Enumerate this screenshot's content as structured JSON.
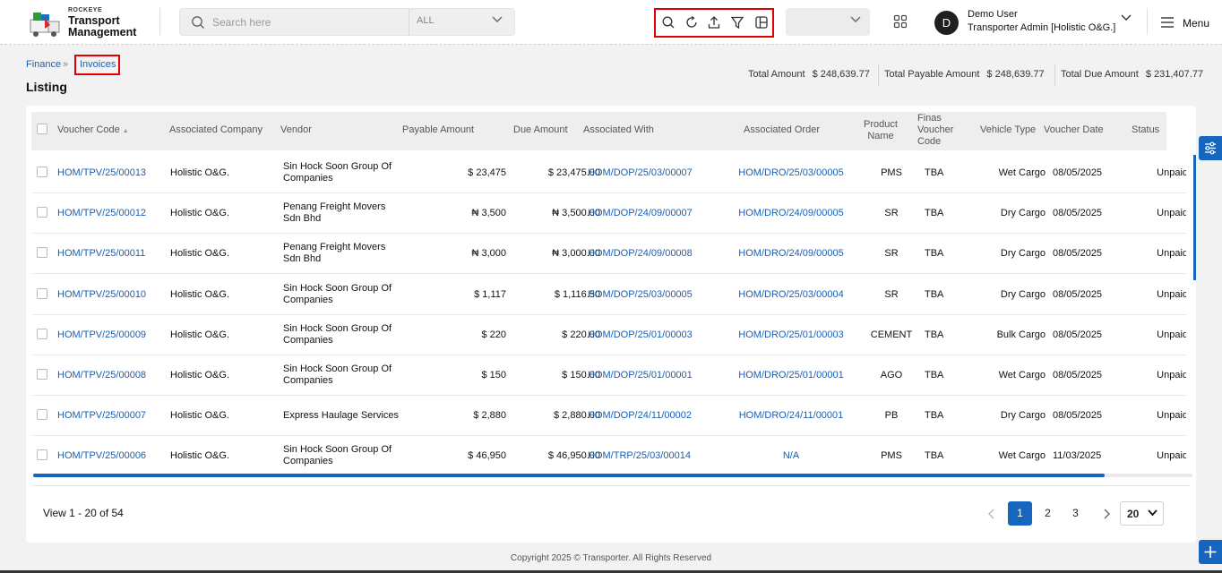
{
  "brand": {
    "small": "ROCKEYE",
    "title_line1": "Transport",
    "title_line2": "Management"
  },
  "search": {
    "placeholder": "Search here",
    "category": "ALL"
  },
  "toolbar": {
    "icons": [
      "search-icon",
      "refresh-icon",
      "upload-icon",
      "filter-icon",
      "columns-icon"
    ]
  },
  "user": {
    "initial": "D",
    "name": "Demo User",
    "role": "Transporter Admin [Holistic O&G.]"
  },
  "menu": {
    "label": "Menu"
  },
  "breadcrumb": {
    "parent": "Finance",
    "sep": "»",
    "current": "Invoices"
  },
  "page": {
    "title": "Listing"
  },
  "totals": {
    "total_amount_label": "Total Amount",
    "total_amount": "$ 248,639.77",
    "total_payable_label": "Total Payable Amount",
    "total_payable": "$ 248,639.77",
    "total_due_label": "Total Due Amount",
    "total_due": "$ 231,407.77"
  },
  "table": {
    "headers": {
      "voucher_code": "Voucher Code",
      "sort_icon": "▲",
      "associated_company": "Associated Company",
      "vendor": "Vendor",
      "payable_amount": "Payable Amount",
      "due_amount": "Due Amount",
      "associated_with": "Associated With",
      "associated_order": "Associated Order",
      "product_name_1": "Product",
      "product_name_2": "Name",
      "finas_1": "Finas",
      "finas_2": "Voucher",
      "finas_3": "Code",
      "vehicle_type": "Vehicle Type",
      "voucher_date": "Voucher Date",
      "status": "Status"
    },
    "rows": [
      {
        "code": "HOM/TPV/25/00013",
        "company": "Holistic O&G.",
        "vendor1": "Sin Hock Soon Group Of",
        "vendor2": "Companies",
        "payable": "$ 23,475",
        "due": "$ 23,475.00",
        "with": "HOM/DOP/25/03/00007",
        "order": "HOM/DRO/25/03/00005",
        "product": "PMS",
        "finas": "TBA",
        "vehicle": "Wet Cargo",
        "date": "08/05/2025",
        "status": "Unpaid"
      },
      {
        "code": "HOM/TPV/25/00012",
        "company": "Holistic O&G.",
        "vendor1": "Penang Freight Movers",
        "vendor2": "Sdn Bhd",
        "payable": "₦ 3,500",
        "due": "₦ 3,500.00",
        "with": "HOM/DOP/24/09/00007",
        "order": "HOM/DRO/24/09/00005",
        "product": "SR",
        "finas": "TBA",
        "vehicle": "Dry Cargo",
        "date": "08/05/2025",
        "status": "Unpaid"
      },
      {
        "code": "HOM/TPV/25/00011",
        "company": "Holistic O&G.",
        "vendor1": "Penang Freight Movers",
        "vendor2": "Sdn Bhd",
        "payable": "₦ 3,000",
        "due": "₦ 3,000.00",
        "with": "HOM/DOP/24/09/00008",
        "order": "HOM/DRO/24/09/00005",
        "product": "SR",
        "finas": "TBA",
        "vehicle": "Dry Cargo",
        "date": "08/05/2025",
        "status": "Unpaid"
      },
      {
        "code": "HOM/TPV/25/00010",
        "company": "Holistic O&G.",
        "vendor1": "Sin Hock Soon Group Of",
        "vendor2": "Companies",
        "payable": "$ 1,117",
        "due": "$ 1,116.50",
        "with": "HOM/DOP/25/03/00005",
        "order": "HOM/DRO/25/03/00004",
        "product": "SR",
        "finas": "TBA",
        "vehicle": "Dry Cargo",
        "date": "08/05/2025",
        "status": "Unpaid"
      },
      {
        "code": "HOM/TPV/25/00009",
        "company": "Holistic O&G.",
        "vendor1": "Sin Hock Soon Group Of",
        "vendor2": "Companies",
        "payable": "$ 220",
        "due": "$ 220.00",
        "with": "HOM/DOP/25/01/00003",
        "order": "HOM/DRO/25/01/00003",
        "product": "CEMENT",
        "finas": "TBA",
        "vehicle": "Bulk Cargo",
        "date": "08/05/2025",
        "status": "Unpaid"
      },
      {
        "code": "HOM/TPV/25/00008",
        "company": "Holistic O&G.",
        "vendor1": "Sin Hock Soon Group Of",
        "vendor2": "Companies",
        "payable": "$ 150",
        "due": "$ 150.00",
        "with": "HOM/DOP/25/01/00001",
        "order": "HOM/DRO/25/01/00001",
        "product": "AGO",
        "finas": "TBA",
        "vehicle": "Wet Cargo",
        "date": "08/05/2025",
        "status": "Unpaid"
      },
      {
        "code": "HOM/TPV/25/00007",
        "company": "Holistic O&G.",
        "vendor1": "Express Haulage Services",
        "vendor2": "",
        "payable": "$ 2,880",
        "due": "$ 2,880.00",
        "with": "HOM/DOP/24/11/00002",
        "order": "HOM/DRO/24/11/00001",
        "product": "PB",
        "finas": "TBA",
        "vehicle": "Dry Cargo",
        "date": "08/05/2025",
        "status": "Unpaid"
      },
      {
        "code": "HOM/TPV/25/00006",
        "company": "Holistic O&G.",
        "vendor1": "Sin Hock Soon Group Of",
        "vendor2": "Companies",
        "payable": "$ 46,950",
        "due": "$ 46,950.00",
        "with": "HOM/TRP/25/03/00014",
        "order": "N/A",
        "product": "PMS",
        "finas": "TBA",
        "vehicle": "Wet Cargo",
        "date": "11/03/2025",
        "status": "Unpaid"
      }
    ]
  },
  "pagination": {
    "summary": "View 1 - 20 of 54",
    "pages": [
      "1",
      "2",
      "3"
    ],
    "active": "1",
    "per_page": "20",
    "prev": "‹",
    "next": "›"
  },
  "footer": {
    "copyright": "Copyright 2025 © Transporter. All Rights Reserved"
  },
  "colors": {
    "accent": "#1666c0",
    "link": "#1a5fb4",
    "highlight_box": "#e00000"
  }
}
